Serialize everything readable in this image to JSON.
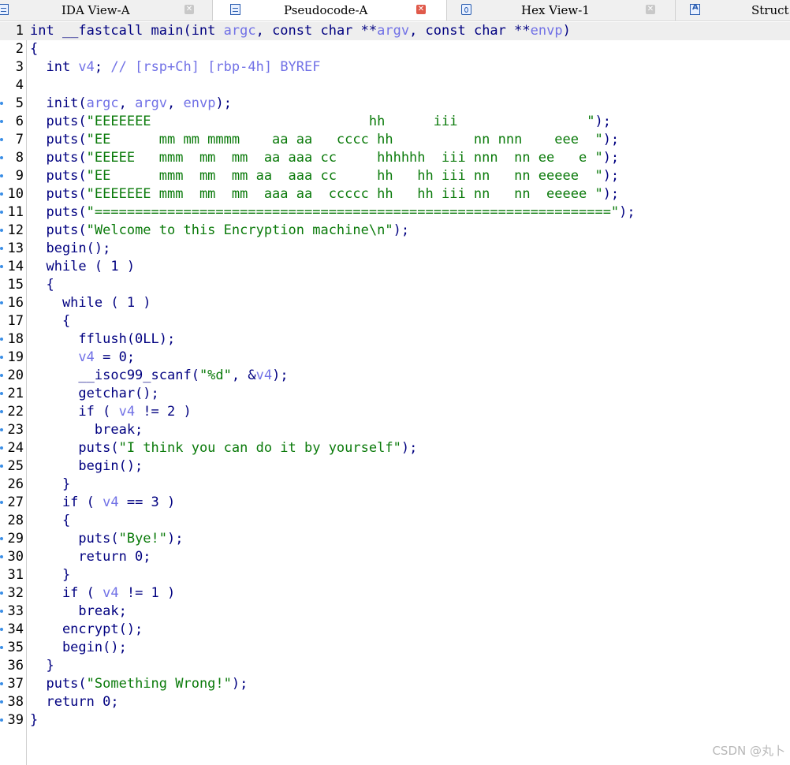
{
  "tabs": [
    {
      "label": "IDA View-A",
      "icon": "list-icon",
      "active": false
    },
    {
      "label": "Pseudocode-A",
      "icon": "list-icon",
      "active": true
    },
    {
      "label": "Hex View-1",
      "icon": "hex-icon",
      "active": false
    },
    {
      "label": "Struct",
      "icon": "struct-icon",
      "active": false
    }
  ],
  "colors": {
    "code": "#000080",
    "variable": "#7171e6",
    "string": "#0a7a0a",
    "comment": "#7171e6",
    "highlight_line": "#eeeeee",
    "active_close": "#e05a4b"
  },
  "code_lines": [
    {
      "n": "1",
      "bp": false,
      "hl": true,
      "tokens": [
        [
          "n",
          "int __fastcall main(int "
        ],
        [
          "v",
          "argc"
        ],
        [
          "n",
          ", const char **"
        ],
        [
          "v",
          "argv"
        ],
        [
          "n",
          ", const char **"
        ],
        [
          "v",
          "envp"
        ],
        [
          "n",
          ")"
        ]
      ]
    },
    {
      "n": "2",
      "bp": false,
      "hl": false,
      "tokens": [
        [
          "n",
          "{"
        ]
      ]
    },
    {
      "n": "3",
      "bp": false,
      "hl": false,
      "tokens": [
        [
          "n",
          "  int "
        ],
        [
          "v",
          "v4"
        ],
        [
          "n",
          "; "
        ],
        [
          "c",
          "// [rsp+Ch] [rbp-4h] BYREF"
        ]
      ]
    },
    {
      "n": "4",
      "bp": false,
      "hl": false,
      "tokens": []
    },
    {
      "n": "5",
      "bp": true,
      "hl": false,
      "tokens": [
        [
          "n",
          "  init("
        ],
        [
          "v",
          "argc"
        ],
        [
          "n",
          ", "
        ],
        [
          "v",
          "argv"
        ],
        [
          "n",
          ", "
        ],
        [
          "v",
          "envp"
        ],
        [
          "n",
          ");"
        ]
      ]
    },
    {
      "n": "6",
      "bp": true,
      "hl": false,
      "tokens": [
        [
          "n",
          "  puts("
        ],
        [
          "s",
          "\"EEEEEEE                           hh      iii                \""
        ],
        [
          "n",
          ");"
        ]
      ]
    },
    {
      "n": "7",
      "bp": true,
      "hl": false,
      "tokens": [
        [
          "n",
          "  puts("
        ],
        [
          "s",
          "\"EE      mm mm mmmm    aa aa   cccc hh          nn nnn    eee  \""
        ],
        [
          "n",
          ");"
        ]
      ]
    },
    {
      "n": "8",
      "bp": true,
      "hl": false,
      "tokens": [
        [
          "n",
          "  puts("
        ],
        [
          "s",
          "\"EEEEE   mmm  mm  mm  aa aaa cc     hhhhhh  iii nnn  nn ee   e \""
        ],
        [
          "n",
          ");"
        ]
      ]
    },
    {
      "n": "9",
      "bp": true,
      "hl": false,
      "tokens": [
        [
          "n",
          "  puts("
        ],
        [
          "s",
          "\"EE      mmm  mm  mm aa  aaa cc     hh   hh iii nn   nn eeeee  \""
        ],
        [
          "n",
          ");"
        ]
      ]
    },
    {
      "n": "10",
      "bp": true,
      "hl": false,
      "tokens": [
        [
          "n",
          "  puts("
        ],
        [
          "s",
          "\"EEEEEEE mmm  mm  mm  aaa aa  ccccc hh   hh iii nn   nn  eeeee \""
        ],
        [
          "n",
          ");"
        ]
      ]
    },
    {
      "n": "11",
      "bp": true,
      "hl": false,
      "tokens": [
        [
          "n",
          "  puts("
        ],
        [
          "s",
          "\"================================================================\""
        ],
        [
          "n",
          ");"
        ]
      ]
    },
    {
      "n": "12",
      "bp": true,
      "hl": false,
      "tokens": [
        [
          "n",
          "  puts("
        ],
        [
          "s",
          "\"Welcome to this Encryption machine\\n\""
        ],
        [
          "n",
          ");"
        ]
      ]
    },
    {
      "n": "13",
      "bp": true,
      "hl": false,
      "tokens": [
        [
          "n",
          "  begin();"
        ]
      ]
    },
    {
      "n": "14",
      "bp": true,
      "hl": false,
      "tokens": [
        [
          "n",
          "  while ( 1 )"
        ]
      ]
    },
    {
      "n": "15",
      "bp": false,
      "hl": false,
      "tokens": [
        [
          "n",
          "  {"
        ]
      ]
    },
    {
      "n": "16",
      "bp": true,
      "hl": false,
      "tokens": [
        [
          "n",
          "    while ( 1 )"
        ]
      ]
    },
    {
      "n": "17",
      "bp": false,
      "hl": false,
      "tokens": [
        [
          "n",
          "    {"
        ]
      ]
    },
    {
      "n": "18",
      "bp": true,
      "hl": false,
      "tokens": [
        [
          "n",
          "      fflush(0LL);"
        ]
      ]
    },
    {
      "n": "19",
      "bp": true,
      "hl": false,
      "tokens": [
        [
          "n",
          "      "
        ],
        [
          "v",
          "v4"
        ],
        [
          "n",
          " = 0;"
        ]
      ]
    },
    {
      "n": "20",
      "bp": true,
      "hl": false,
      "tokens": [
        [
          "n",
          "      __isoc99_scanf("
        ],
        [
          "s",
          "\"%d\""
        ],
        [
          "n",
          ", &"
        ],
        [
          "v",
          "v4"
        ],
        [
          "n",
          ");"
        ]
      ]
    },
    {
      "n": "21",
      "bp": true,
      "hl": false,
      "tokens": [
        [
          "n",
          "      getchar();"
        ]
      ]
    },
    {
      "n": "22",
      "bp": true,
      "hl": false,
      "tokens": [
        [
          "n",
          "      if ( "
        ],
        [
          "v",
          "v4"
        ],
        [
          "n",
          " != 2 )"
        ]
      ]
    },
    {
      "n": "23",
      "bp": true,
      "hl": false,
      "tokens": [
        [
          "n",
          "        break;"
        ]
      ]
    },
    {
      "n": "24",
      "bp": true,
      "hl": false,
      "tokens": [
        [
          "n",
          "      puts("
        ],
        [
          "s",
          "\"I think you can do it by yourself\""
        ],
        [
          "n",
          ");"
        ]
      ]
    },
    {
      "n": "25",
      "bp": true,
      "hl": false,
      "tokens": [
        [
          "n",
          "      begin();"
        ]
      ]
    },
    {
      "n": "26",
      "bp": false,
      "hl": false,
      "tokens": [
        [
          "n",
          "    }"
        ]
      ]
    },
    {
      "n": "27",
      "bp": true,
      "hl": false,
      "tokens": [
        [
          "n",
          "    if ( "
        ],
        [
          "v",
          "v4"
        ],
        [
          "n",
          " == 3 )"
        ]
      ]
    },
    {
      "n": "28",
      "bp": false,
      "hl": false,
      "tokens": [
        [
          "n",
          "    {"
        ]
      ]
    },
    {
      "n": "29",
      "bp": true,
      "hl": false,
      "tokens": [
        [
          "n",
          "      puts("
        ],
        [
          "s",
          "\"Bye!\""
        ],
        [
          "n",
          ");"
        ]
      ]
    },
    {
      "n": "30",
      "bp": true,
      "hl": false,
      "tokens": [
        [
          "n",
          "      return 0;"
        ]
      ]
    },
    {
      "n": "31",
      "bp": false,
      "hl": false,
      "tokens": [
        [
          "n",
          "    }"
        ]
      ]
    },
    {
      "n": "32",
      "bp": true,
      "hl": false,
      "tokens": [
        [
          "n",
          "    if ( "
        ],
        [
          "v",
          "v4"
        ],
        [
          "n",
          " != 1 )"
        ]
      ]
    },
    {
      "n": "33",
      "bp": true,
      "hl": false,
      "tokens": [
        [
          "n",
          "      break;"
        ]
      ]
    },
    {
      "n": "34",
      "bp": true,
      "hl": false,
      "tokens": [
        [
          "n",
          "    encrypt();"
        ]
      ]
    },
    {
      "n": "35",
      "bp": true,
      "hl": false,
      "tokens": [
        [
          "n",
          "    begin();"
        ]
      ]
    },
    {
      "n": "36",
      "bp": false,
      "hl": false,
      "tokens": [
        [
          "n",
          "  }"
        ]
      ]
    },
    {
      "n": "37",
      "bp": true,
      "hl": false,
      "tokens": [
        [
          "n",
          "  puts("
        ],
        [
          "s",
          "\"Something Wrong!\""
        ],
        [
          "n",
          ");"
        ]
      ]
    },
    {
      "n": "38",
      "bp": true,
      "hl": false,
      "tokens": [
        [
          "n",
          "  return 0;"
        ]
      ]
    },
    {
      "n": "39",
      "bp": true,
      "hl": false,
      "tokens": [
        [
          "n",
          "}"
        ]
      ]
    }
  ],
  "watermark": "CSDN @丸卜"
}
